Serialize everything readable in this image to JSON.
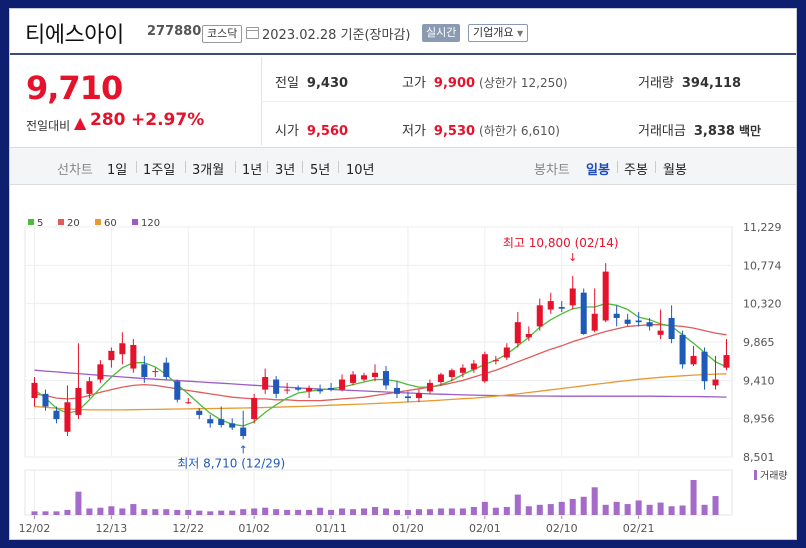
{
  "header": {
    "name": "티에스아이",
    "code": "277880",
    "market": "코스닥",
    "date": "2023.02.28 기준(장마감)",
    "realtime": "실시간",
    "company": "기업개요"
  },
  "summary": {
    "price": "9,710",
    "change_label": "전일대비",
    "change_symbol": "▲",
    "change": "280",
    "change_pct": "+2.97%"
  },
  "info": {
    "prev_label": "전일",
    "prev": "9,430",
    "high_label": "고가",
    "high": "9,900",
    "upper_label": "(상한가",
    "upper": "12,250)",
    "volume_label": "거래량",
    "volume": "394,118",
    "open_label": "시가",
    "open": "9,560",
    "low_label": "저가",
    "low": "9,530",
    "lower_label": "(하한가",
    "lower": "6,610)",
    "amount_label": "거래대금",
    "amount": "3,838",
    "amount_unit": "백만"
  },
  "tabs": {
    "line_label": "선차트",
    "line": [
      "1일",
      "1주일",
      "3개월",
      "1년",
      "3년",
      "5년",
      "10년"
    ],
    "candle_label": "봉차트",
    "candle": [
      "일봉",
      "주봉",
      "월봉"
    ],
    "candle_selected": 0
  },
  "colors": {
    "up": "#e4122b",
    "down": "#1f5ab9",
    "accent": "#1f4cb6"
  },
  "chart_data": {
    "type": "candlestick",
    "legend": [
      {
        "name": "5",
        "color": "#4dbb3a"
      },
      {
        "name": "20",
        "color": "#e15b5b"
      },
      {
        "name": "60",
        "color": "#e89a32"
      },
      {
        "name": "120",
        "color": "#9c5bc5"
      }
    ],
    "y_ticks": [
      "11,229",
      "10,774",
      "10,320",
      "9,865",
      "9,410",
      "8,956",
      "8,501"
    ],
    "ylim": [
      8501,
      11229
    ],
    "x_ticks": [
      {
        "label": "12/02",
        "index": 0
      },
      {
        "label": "12/13",
        "index": 7
      },
      {
        "label": "12/22",
        "index": 14
      },
      {
        "label": "01/02",
        "index": 20
      },
      {
        "label": "01/11",
        "index": 27
      },
      {
        "label": "01/20",
        "index": 34
      },
      {
        "label": "02/01",
        "index": 41
      },
      {
        "label": "02/10",
        "index": 48
      },
      {
        "label": "02/21",
        "index": 55
      }
    ],
    "annotation_high": {
      "text": "최고 10,800 (02/14)",
      "index": 49,
      "value": 10800
    },
    "annotation_low": {
      "text": "최저 8,710 (12/29)",
      "index": 19,
      "value": 8710
    },
    "volume_label": "거래량",
    "candles": [
      {
        "o": 9200,
        "h": 9450,
        "l": 9100,
        "c": 9380
      },
      {
        "o": 9250,
        "h": 9300,
        "l": 9050,
        "c": 9100
      },
      {
        "o": 9050,
        "h": 9100,
        "l": 8900,
        "c": 8950
      },
      {
        "o": 8800,
        "h": 9350,
        "l": 8750,
        "c": 9150
      },
      {
        "o": 9000,
        "h": 9850,
        "l": 8950,
        "c": 9320
      },
      {
        "o": 9250,
        "h": 9450,
        "l": 9200,
        "c": 9400
      },
      {
        "o": 9420,
        "h": 9650,
        "l": 9380,
        "c": 9600
      },
      {
        "o": 9650,
        "h": 9800,
        "l": 9560,
        "c": 9760
      },
      {
        "o": 9720,
        "h": 9980,
        "l": 9600,
        "c": 9850
      },
      {
        "o": 9550,
        "h": 9900,
        "l": 9500,
        "c": 9830
      },
      {
        "o": 9600,
        "h": 9700,
        "l": 9380,
        "c": 9450
      },
      {
        "o": 9520,
        "h": 9560,
        "l": 9450,
        "c": 9520
      },
      {
        "o": 9620,
        "h": 9680,
        "l": 9420,
        "c": 9450
      },
      {
        "o": 9400,
        "h": 9420,
        "l": 9150,
        "c": 9180
      },
      {
        "o": 9150,
        "h": 9200,
        "l": 9130,
        "c": 9150
      },
      {
        "o": 9050,
        "h": 9080,
        "l": 8950,
        "c": 9000
      },
      {
        "o": 8950,
        "h": 9000,
        "l": 8850,
        "c": 8900
      },
      {
        "o": 8950,
        "h": 9100,
        "l": 8850,
        "c": 8880
      },
      {
        "o": 8900,
        "h": 8960,
        "l": 8820,
        "c": 8850
      },
      {
        "o": 8850,
        "h": 9050,
        "l": 8710,
        "c": 8750
      },
      {
        "o": 8950,
        "h": 9250,
        "l": 8900,
        "c": 9200
      },
      {
        "o": 9300,
        "h": 9550,
        "l": 9250,
        "c": 9450
      },
      {
        "o": 9420,
        "h": 9460,
        "l": 9200,
        "c": 9250
      },
      {
        "o": 9300,
        "h": 9380,
        "l": 9250,
        "c": 9300
      },
      {
        "o": 9320,
        "h": 9350,
        "l": 9280,
        "c": 9300
      },
      {
        "o": 9280,
        "h": 9350,
        "l": 9200,
        "c": 9320
      },
      {
        "o": 9300,
        "h": 9360,
        "l": 9250,
        "c": 9280
      },
      {
        "o": 9320,
        "h": 9380,
        "l": 9280,
        "c": 9300
      },
      {
        "o": 9300,
        "h": 9480,
        "l": 9280,
        "c": 9420
      },
      {
        "o": 9380,
        "h": 9520,
        "l": 9350,
        "c": 9480
      },
      {
        "o": 9420,
        "h": 9500,
        "l": 9400,
        "c": 9470
      },
      {
        "o": 9450,
        "h": 9600,
        "l": 9400,
        "c": 9500
      },
      {
        "o": 9520,
        "h": 9580,
        "l": 9300,
        "c": 9350
      },
      {
        "o": 9320,
        "h": 9400,
        "l": 9200,
        "c": 9250
      },
      {
        "o": 9220,
        "h": 9280,
        "l": 9150,
        "c": 9200
      },
      {
        "o": 9200,
        "h": 9300,
        "l": 9150,
        "c": 9260
      },
      {
        "o": 9280,
        "h": 9420,
        "l": 9250,
        "c": 9380
      },
      {
        "o": 9390,
        "h": 9500,
        "l": 9350,
        "c": 9480
      },
      {
        "o": 9450,
        "h": 9550,
        "l": 9400,
        "c": 9530
      },
      {
        "o": 9500,
        "h": 9600,
        "l": 9450,
        "c": 9560
      },
      {
        "o": 9540,
        "h": 9650,
        "l": 9500,
        "c": 9610
      },
      {
        "o": 9400,
        "h": 9750,
        "l": 9380,
        "c": 9720
      },
      {
        "o": 9640,
        "h": 9700,
        "l": 9600,
        "c": 9650
      },
      {
        "o": 9680,
        "h": 9850,
        "l": 9650,
        "c": 9800
      },
      {
        "o": 9850,
        "h": 10220,
        "l": 9800,
        "c": 10100
      },
      {
        "o": 9920,
        "h": 10050,
        "l": 9880,
        "c": 9960
      },
      {
        "o": 10050,
        "h": 10380,
        "l": 10000,
        "c": 10300
      },
      {
        "o": 10250,
        "h": 10450,
        "l": 10200,
        "c": 10350
      },
      {
        "o": 10280,
        "h": 10350,
        "l": 10220,
        "c": 10260
      },
      {
        "o": 10300,
        "h": 10650,
        "l": 10250,
        "c": 10500
      },
      {
        "o": 10450,
        "h": 10500,
        "l": 9950,
        "c": 9960
      },
      {
        "o": 10000,
        "h": 10500,
        "l": 9980,
        "c": 10200
      },
      {
        "o": 10120,
        "h": 10800,
        "l": 10100,
        "c": 10700
      },
      {
        "o": 10200,
        "h": 10300,
        "l": 10050,
        "c": 10150
      },
      {
        "o": 10130,
        "h": 10200,
        "l": 10050,
        "c": 10080
      },
      {
        "o": 10120,
        "h": 10220,
        "l": 10050,
        "c": 10100
      },
      {
        "o": 10100,
        "h": 10150,
        "l": 10000,
        "c": 10050
      },
      {
        "o": 9950,
        "h": 10250,
        "l": 9900,
        "c": 10000
      },
      {
        "o": 10150,
        "h": 10300,
        "l": 9850,
        "c": 9900
      },
      {
        "o": 9950,
        "h": 10000,
        "l": 9550,
        "c": 9600
      },
      {
        "o": 9600,
        "h": 9820,
        "l": 9580,
        "c": 9700
      },
      {
        "o": 9750,
        "h": 9800,
        "l": 9300,
        "c": 9400
      },
      {
        "o": 9350,
        "h": 9700,
        "l": 9300,
        "c": 9420
      },
      {
        "o": 9560,
        "h": 9900,
        "l": 9530,
        "c": 9710
      }
    ],
    "volumes": [
      5,
      5,
      5,
      7,
      32,
      9,
      10,
      12,
      9,
      15,
      8,
      8,
      8,
      7,
      7,
      6,
      5,
      6,
      6,
      8,
      9,
      10,
      8,
      7,
      7,
      7,
      10,
      7,
      9,
      8,
      9,
      11,
      9,
      7,
      7,
      8,
      8,
      9,
      9,
      9,
      11,
      18,
      10,
      11,
      28,
      12,
      14,
      15,
      18,
      22,
      25,
      38,
      14,
      18,
      15,
      20,
      14,
      17,
      12,
      13,
      48,
      14,
      26
    ],
    "ma5": [
      9300,
      9200,
      9080,
      9020,
      9050,
      9180,
      9320,
      9450,
      9560,
      9620,
      9620,
      9570,
      9480,
      9360,
      9250,
      9130,
      9020,
      8940,
      8890,
      8870,
      8920,
      9030,
      9120,
      9200,
      9260,
      9280,
      9300,
      9310,
      9330,
      9360,
      9390,
      9420,
      9420,
      9400,
      9360,
      9330,
      9330,
      9360,
      9410,
      9480,
      9540,
      9600,
      9650,
      9720,
      9820,
      9920,
      10040,
      10130,
      10200,
      10260,
      10280,
      10280,
      10320,
      10300,
      10250,
      10160,
      10130,
      10080,
      10050,
      9950,
      9850,
      9740,
      9630,
      9570
    ],
    "ma20": [
      9250,
      9230,
      9200,
      9190,
      9200,
      9230,
      9270,
      9300,
      9330,
      9350,
      9360,
      9350,
      9330,
      9310,
      9290,
      9270,
      9250,
      9230,
      9210,
      9200,
      9190,
      9190,
      9180,
      9180,
      9170,
      9170,
      9170,
      9180,
      9190,
      9200,
      9210,
      9230,
      9250,
      9270,
      9290,
      9310,
      9330,
      9350,
      9380,
      9410,
      9450,
      9490,
      9530,
      9580,
      9630,
      9680,
      9730,
      9780,
      9820,
      9870,
      9910,
      9950,
      9990,
      10020,
      10050,
      10060,
      10070,
      10070,
      10060,
      10050,
      10030,
      10000,
      9970,
      9950
    ],
    "ma60": [
      9100,
      9090,
      9080,
      9070,
      9065,
      9060,
      9060,
      9060,
      9060,
      9062,
      9064,
      9066,
      9068,
      9070,
      9072,
      9074,
      9076,
      9078,
      9080,
      9082,
      9084,
      9088,
      9092,
      9096,
      9100,
      9105,
      9110,
      9115,
      9120,
      9125,
      9130,
      9136,
      9142,
      9148,
      9154,
      9160,
      9168,
      9176,
      9184,
      9192,
      9200,
      9210,
      9222,
      9236,
      9250,
      9266,
      9282,
      9298,
      9314,
      9330,
      9346,
      9362,
      9378,
      9394,
      9408,
      9422,
      9434,
      9446,
      9456,
      9464,
      9472,
      9478,
      9484,
      9488
    ],
    "ma120": [
      9530,
      9520,
      9510,
      9500,
      9490,
      9480,
      9470,
      9460,
      9450,
      9440,
      9432,
      9424,
      9416,
      9408,
      9400,
      9392,
      9384,
      9376,
      9368,
      9360,
      9352,
      9344,
      9336,
      9328,
      9320,
      9314,
      9308,
      9302,
      9296,
      9290,
      9284,
      9278,
      9272,
      9266,
      9260,
      9255,
      9250,
      9246,
      9242,
      9238,
      9235,
      9232,
      9230,
      9228,
      9226,
      9225,
      9224,
      9223,
      9222,
      9222,
      9222,
      9222,
      9222,
      9222,
      9222,
      9222,
      9222,
      9221,
      9220,
      9219,
      9218,
      9216,
      9214,
      9212
    ]
  }
}
